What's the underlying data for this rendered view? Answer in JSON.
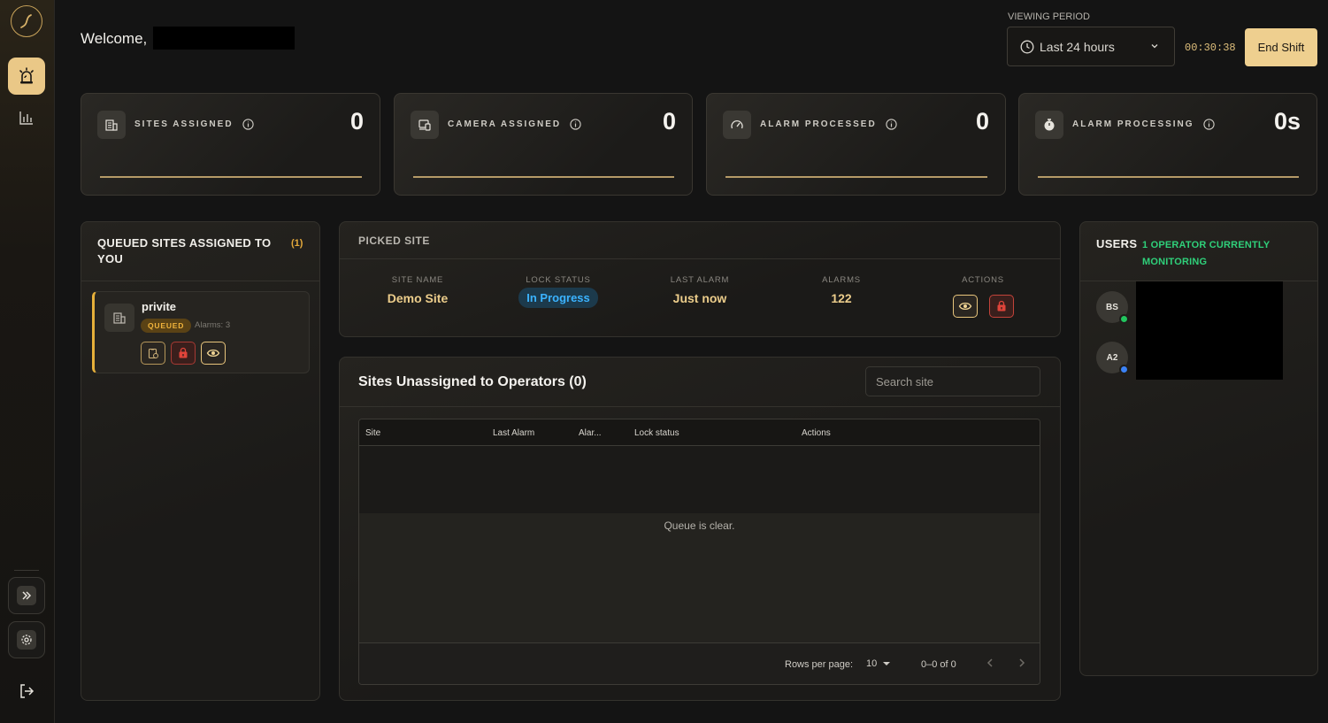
{
  "header": {
    "welcome": "Welcome,",
    "viewing_period_label": "VIEWING PERIOD",
    "viewing_period_value": "Last 24 hours",
    "timer": "00:30:38",
    "end_shift": "End Shift"
  },
  "stats": [
    {
      "label": "SITES ASSIGNED",
      "value": "0",
      "icon": "building-icon"
    },
    {
      "label": "CAMERA ASSIGNED",
      "value": "0",
      "icon": "camera-device-icon"
    },
    {
      "label": "ALARM PROCESSED",
      "value": "0",
      "icon": "gauge-icon"
    },
    {
      "label": "ALARM PROCESSING",
      "value": "0s",
      "icon": "stopwatch-icon"
    }
  ],
  "queued": {
    "title": "QUEUED SITES ASSIGNED TO YOU",
    "count": "(1)",
    "items": [
      {
        "name": "privite",
        "badge": "QUEUED",
        "alarms": "Alarms: 3"
      }
    ]
  },
  "picked": {
    "title": "PICKED SITE",
    "columns": {
      "site_name": "SITE NAME",
      "lock_status": "LOCK STATUS",
      "last_alarm": "LAST ALARM",
      "alarms": "ALARMS",
      "actions": "ACTIONS"
    },
    "row": {
      "site_name": "Demo Site",
      "lock_status": "In Progress",
      "last_alarm": "Just now",
      "alarms": "122"
    }
  },
  "unassigned": {
    "title": "Sites Unassigned to Operators (0)",
    "search_placeholder": "Search site",
    "columns": [
      "Site",
      "Last Alarm",
      "Alar...",
      "Lock status",
      "Actions"
    ],
    "empty": "Queue is clear.",
    "rows_per_page_label": "Rows per page:",
    "rows_per_page_value": "10",
    "range": "0–0 of 0"
  },
  "users": {
    "title": "USERS",
    "subtitle": "1 OPERATOR CURRENTLY MONITORING",
    "list": [
      {
        "initials": "BS",
        "status_color": "#22c55e"
      },
      {
        "initials": "A2",
        "status_color": "#3b82f6"
      }
    ]
  },
  "colors": {
    "accent": "#eecf8f",
    "warning": "#e6b03a",
    "danger": "#e0443a",
    "info": "#3bb3ff",
    "success": "#2fd07a"
  }
}
